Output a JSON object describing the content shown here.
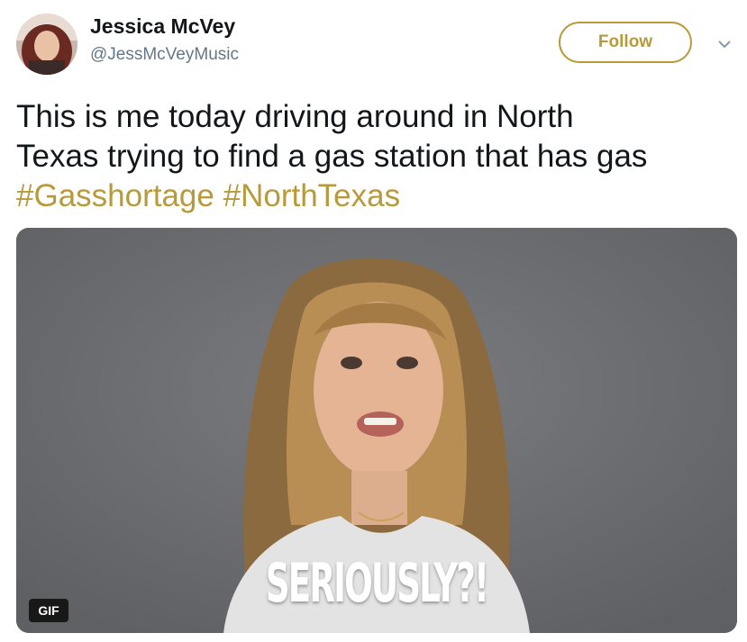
{
  "author": {
    "display_name": "Jessica McVey",
    "handle": "@JessMcVeyMusic",
    "avatar_icon": "profile-photo"
  },
  "actions": {
    "follow_label": "Follow",
    "menu_icon": "chevron-down-icon"
  },
  "tweet": {
    "line1": "This is me today driving around in North",
    "line2": "Texas trying to find a gas station that has gas",
    "hashtags": [
      "#Gasshortage",
      "#NorthTexas"
    ]
  },
  "media": {
    "type": "gif",
    "caption": "SERIOUSLY?!",
    "badge": "GIF"
  },
  "colors": {
    "accent": "#b79a3c",
    "text": "#14171a",
    "secondary": "#657786",
    "media_background": "#6e6e70"
  }
}
